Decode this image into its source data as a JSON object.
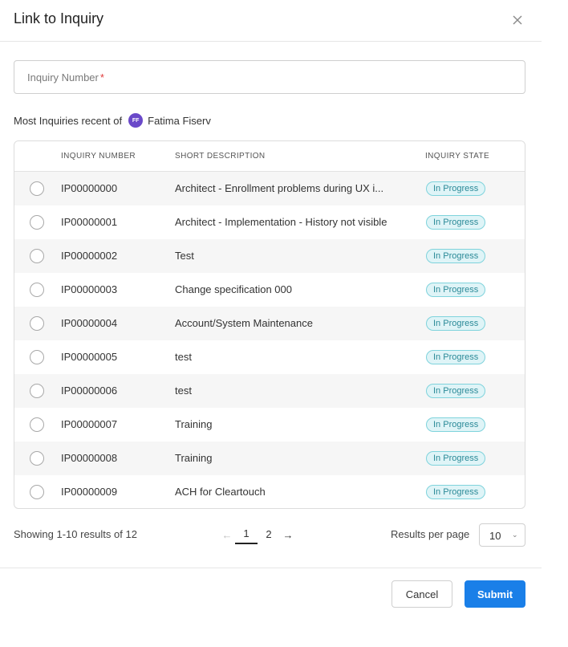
{
  "dialog": {
    "title": "Link to Inquiry",
    "close_icon": "close-icon"
  },
  "inquiry_field": {
    "placeholder": "Inquiry Number",
    "required_mark": "*"
  },
  "recent": {
    "prefix": "Most Inquiries recent of",
    "avatar_initials": "FF",
    "user_name": "Fatima Fiserv",
    "avatar_color": "#6a49c9"
  },
  "table": {
    "headers": {
      "inquiry_number": "INQUIRY NUMBER",
      "short_description": "SHORT DESCRIPTION",
      "inquiry_state": "INQUIRY STATE"
    },
    "rows": [
      {
        "number": "IP00000000",
        "description": "Architect - Enrollment problems during UX i...",
        "state": "In Progress"
      },
      {
        "number": "IP00000001",
        "description": "Architect - Implementation - History not visible",
        "state": "In Progress"
      },
      {
        "number": "IP00000002",
        "description": "Test",
        "state": "In Progress"
      },
      {
        "number": "IP00000003",
        "description": "Change specification 000",
        "state": "In Progress"
      },
      {
        "number": "IP00000004",
        "description": "Account/System Maintenance",
        "state": "In Progress"
      },
      {
        "number": "IP00000005",
        "description": "test",
        "state": "In Progress"
      },
      {
        "number": "IP00000006",
        "description": "test",
        "state": "In Progress"
      },
      {
        "number": "IP00000007",
        "description": "Training",
        "state": "In Progress"
      },
      {
        "number": "IP00000008",
        "description": "Training",
        "state": "In Progress"
      },
      {
        "number": "IP00000009",
        "description": "ACH for Cleartouch",
        "state": "In Progress"
      }
    ]
  },
  "pagination": {
    "showing_text": "Showing 1-10 results of 12",
    "prev_arrow": "←",
    "next_arrow": "→",
    "pages": [
      "1",
      "2"
    ],
    "current_page": "1",
    "results_per_page_label": "Results per page",
    "results_per_page_value": "10"
  },
  "buttons": {
    "cancel": "Cancel",
    "submit": "Submit"
  },
  "colors": {
    "primary": "#1a7fe8",
    "badge_bg": "#dff4f7",
    "badge_text": "#2b8a98"
  }
}
